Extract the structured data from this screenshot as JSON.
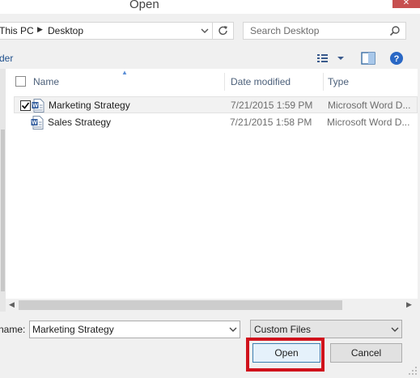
{
  "window": {
    "title": "Open",
    "close_glyph": "✕"
  },
  "address_bar": {
    "crumbs": [
      "This PC",
      "Desktop"
    ],
    "separator_glyph": "▶",
    "dropdown_icon": "chevron-down-icon",
    "refresh_icon": "refresh-icon"
  },
  "search": {
    "placeholder": "Search Desktop",
    "icon": "search-icon"
  },
  "toolbar": {
    "new_folder_label": "der",
    "view_icon": "view-options-icon",
    "preview_icon": "preview-pane-icon",
    "help_icon": "help-icon"
  },
  "file_list": {
    "columns": [
      "Name",
      "Date modified",
      "Type"
    ],
    "rows": [
      {
        "name": "Marketing Strategy",
        "date": "7/21/2015 1:59 PM",
        "type": "Microsoft Word D...",
        "checked": true,
        "selected": true
      },
      {
        "name": "Sales Strategy",
        "date": "7/21/2015 1:58 PM",
        "type": "Microsoft Word D...",
        "checked": false,
        "selected": false
      }
    ]
  },
  "bottom": {
    "file_name_label": "name:",
    "file_name_value": "Marketing Strategy",
    "file_type_value": "Custom Files",
    "open_label": "Open",
    "cancel_label": "Cancel"
  },
  "colors": {
    "highlight": "#d0121c",
    "accent": "#1e4f8c",
    "word_blue": "#2b579a"
  }
}
